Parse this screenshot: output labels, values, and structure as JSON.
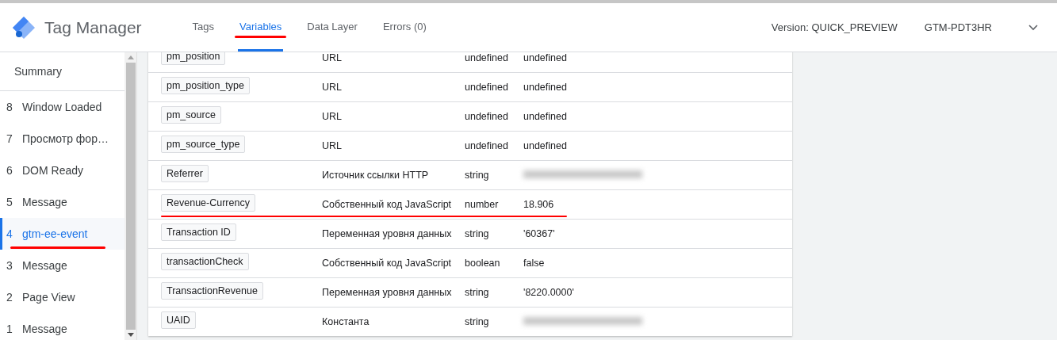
{
  "app": {
    "title": "Tag Manager"
  },
  "tabs": [
    {
      "label": "Tags",
      "selected": false,
      "annotated": false
    },
    {
      "label": "Variables",
      "selected": true,
      "annotated": true
    },
    {
      "label": "Data Layer",
      "selected": false,
      "annotated": false
    },
    {
      "label": "Errors (0)",
      "selected": false,
      "annotated": false
    }
  ],
  "version": "Version: QUICK_PREVIEW",
  "container_id": "GTM-PDT3HR",
  "sidebar": {
    "summary": "Summary",
    "items": [
      {
        "number": "8",
        "label": "Window Loaded",
        "selected": false,
        "annotated": false
      },
      {
        "number": "7",
        "label": "Просмотр фор…",
        "selected": false,
        "annotated": false
      },
      {
        "number": "6",
        "label": "DOM Ready",
        "selected": false,
        "annotated": false
      },
      {
        "number": "5",
        "label": "Message",
        "selected": false,
        "annotated": false
      },
      {
        "number": "4",
        "label": "gtm-ee-event",
        "selected": true,
        "annotated": true
      },
      {
        "number": "3",
        "label": "Message",
        "selected": false,
        "annotated": false
      },
      {
        "number": "2",
        "label": "Page View",
        "selected": false,
        "annotated": false
      },
      {
        "number": "1",
        "label": "Message",
        "selected": false,
        "annotated": false
      }
    ]
  },
  "table": {
    "rows": [
      {
        "name": "pm_position",
        "type": "URL",
        "data_type": "undefined",
        "value": "undefined",
        "annotated": false
      },
      {
        "name": "pm_position_type",
        "type": "URL",
        "data_type": "undefined",
        "value": "undefined",
        "annotated": false
      },
      {
        "name": "pm_source",
        "type": "URL",
        "data_type": "undefined",
        "value": "undefined",
        "annotated": false
      },
      {
        "name": "pm_source_type",
        "type": "URL",
        "data_type": "undefined",
        "value": "undefined",
        "annotated": false
      },
      {
        "name": "Referrer",
        "type": "Источник ссылки HTTP",
        "data_type": "string",
        "redacted": true,
        "annotated": false
      },
      {
        "name": "Revenue-Currency",
        "type": "Собственный код JavaScript",
        "data_type": "number",
        "value": "18.906",
        "annotated": true
      },
      {
        "name": "Transaction ID",
        "type": "Переменная уровня данных",
        "data_type": "string",
        "value": "'60367'",
        "annotated": false
      },
      {
        "name": "transactionCheck",
        "type": "Собственный код JavaScript",
        "data_type": "boolean",
        "value": "false",
        "annotated": false
      },
      {
        "name": "TransactionRevenue",
        "type": "Переменная уровня данных",
        "data_type": "string",
        "value": "'8220.0000'",
        "annotated": false
      },
      {
        "name": "UAID",
        "type": "Константа",
        "data_type": "string",
        "redacted": true,
        "annotated": false
      }
    ]
  }
}
